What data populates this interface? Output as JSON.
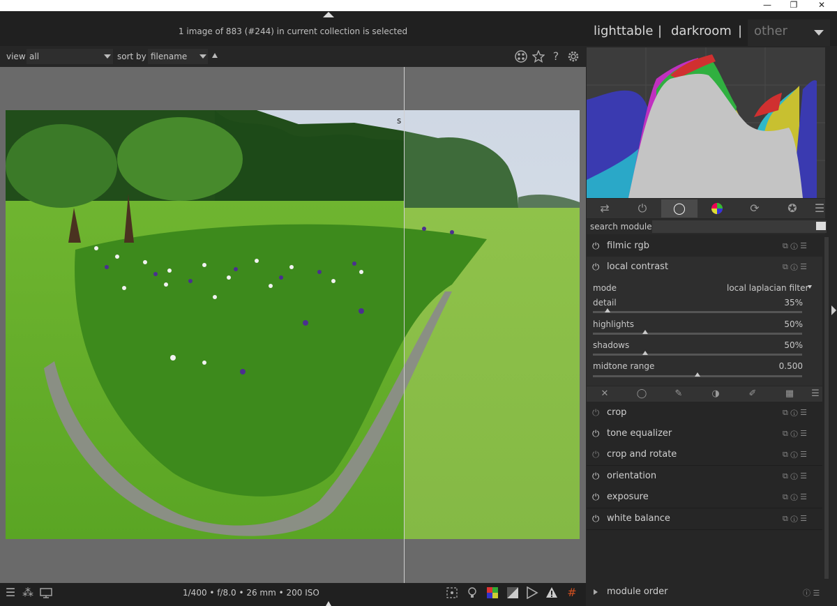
{
  "window": {
    "minimize": "—",
    "maximize": "❐",
    "close": "✕"
  },
  "header": {
    "status_text": "1 image of 883 (#244) in current collection is selected",
    "views": [
      "lighttable",
      "darkroom",
      "other"
    ],
    "separator": "|"
  },
  "filterbar": {
    "view_label": "view",
    "view_value": "all",
    "sort_label": "sort by",
    "sort_value": "filename"
  },
  "center": {
    "split_label": "s"
  },
  "bottombar": {
    "exif": "1/400 • f/8.0 • 26 mm • 200 ISO"
  },
  "panel": {
    "search_label": "search module",
    "search_value": "",
    "active_modules": [
      {
        "name": "filmic rgb"
      },
      {
        "name": "local contrast"
      }
    ],
    "local_contrast": {
      "mode_label": "mode",
      "mode_value": "local laplacian filter",
      "params": [
        {
          "label": "detail",
          "value": "35%",
          "fraction": 0.07
        },
        {
          "label": "highlights",
          "value": "50%",
          "fraction": 0.25
        },
        {
          "label": "shadows",
          "value": "50%",
          "fraction": 0.25
        },
        {
          "label": "midtone range",
          "value": "0.500",
          "fraction": 0.5
        }
      ]
    },
    "other_modules": [
      {
        "name": "crop",
        "dim": true
      },
      {
        "name": "tone equalizer",
        "dim": false
      },
      {
        "name": "crop and rotate",
        "dim": true
      },
      {
        "name": "orientation",
        "dim": false
      },
      {
        "name": "exposure",
        "dim": false
      },
      {
        "name": "white balance",
        "dim": false
      }
    ],
    "module_order_label": "module order"
  },
  "colors": {
    "accent": "#d8d8d8",
    "panel_bg": "#262626",
    "center_bg": "#6a6a6a"
  }
}
